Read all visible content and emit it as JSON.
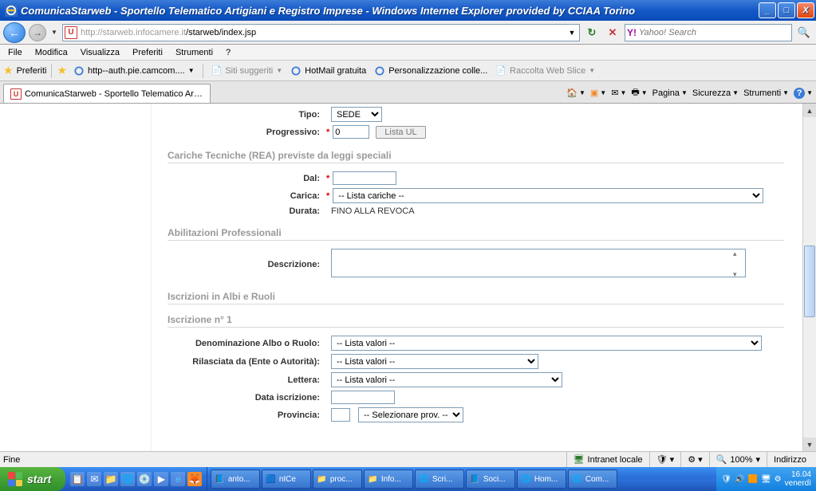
{
  "window": {
    "title": "ComunicaStarweb - Sportello Telematico Artigiani e Registro Imprese - Windows Internet Explorer provided by CCIAA Torino"
  },
  "address": {
    "url_host": "http://starweb.infocamere.it",
    "url_path": "/starweb/index.jsp"
  },
  "search": {
    "placeholder": "Yahoo! Search"
  },
  "menu": {
    "file": "File",
    "modifica": "Modifica",
    "visualizza": "Visualizza",
    "preferiti": "Preferiti",
    "strumenti": "Strumenti",
    "help": "?"
  },
  "favbar": {
    "label": "Preferiti",
    "links": [
      "http--auth.pie.camcom....",
      "Siti suggeriti",
      "HotMail gratuita",
      "Personalizzazione colle...",
      "Raccolta Web Slice"
    ]
  },
  "tab": {
    "title": "ComunicaStarweb - Sportello Telematico Art..."
  },
  "toolbar": {
    "pagina": "Pagina",
    "sicurezza": "Sicurezza",
    "strumenti": "Strumenti"
  },
  "form": {
    "tipo_label": "Tipo:",
    "tipo_value": "SEDE",
    "progressivo_label": "Progressivo:",
    "progressivo_value": "0",
    "lista_ul": "Lista UL",
    "sec_cariche": "Cariche Tecniche (REA) previste da leggi speciali",
    "dal": "Dal:",
    "carica": "Carica:",
    "carica_value": "-- Lista cariche --",
    "durata": "Durata:",
    "durata_value": "FINO ALLA REVOCA",
    "sec_abilitazioni": "Abilitazioni Professionali",
    "descrizione": "Descrizione:",
    "sec_iscrizioni": "Iscrizioni in Albi e Ruoli",
    "sec_iscr1": "Iscrizione n° 1",
    "denominazione": "Denominazione Albo o Ruolo:",
    "den_value": "-- Lista valori --",
    "rilasciata": "Rilasciata da (Ente o Autorità):",
    "ril_value": "-- Lista valori --",
    "lettera": "Lettera:",
    "let_value": "-- Lista valori --",
    "data_iscrizione": "Data iscrizione:",
    "provincia": "Provincia:",
    "prov_value": "-- Selezionare prov. --"
  },
  "status": {
    "fine": "Fine",
    "intranet": "Intranet locale",
    "zoom": "100%",
    "indirizzo": "Indirizzo"
  },
  "taskbar": {
    "start": "start",
    "tasks": [
      "anto...",
      "nICe",
      "proc...",
      "Info...",
      "Scri...",
      "Soci...",
      "Hom...",
      "Com..."
    ],
    "clock_time": "16.04",
    "clock_day": "venerdì"
  }
}
